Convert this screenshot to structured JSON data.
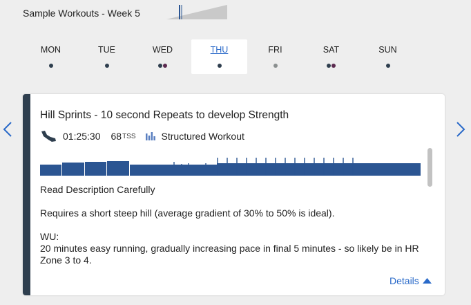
{
  "header": {
    "title": "Sample Workouts - Week 5"
  },
  "days": [
    {
      "label": "MON",
      "dots": [
        "#2e3e4e"
      ],
      "active": false
    },
    {
      "label": "TUE",
      "dots": [
        "#2e3e4e"
      ],
      "active": false
    },
    {
      "label": "WED",
      "dots": [
        "#2e3e4e",
        "#5b2a4f"
      ],
      "active": false
    },
    {
      "label": "THU",
      "dots": [
        "#2e3e4e"
      ],
      "active": true
    },
    {
      "label": "FRI",
      "dots": [
        "#8a8f8f"
      ],
      "active": false
    },
    {
      "label": "SAT",
      "dots": [
        "#2e3e4e",
        "#5b2a4f"
      ],
      "active": false
    },
    {
      "label": "SUN",
      "dots": [
        "#2e3e4e"
      ],
      "active": false
    }
  ],
  "nav": {
    "prev_icon": "chevron-left-icon",
    "next_icon": "chevron-right-icon"
  },
  "workout": {
    "title": "Hill Sprints - 10 second Repeats to develop Strength",
    "sport_icon": "running-shoe-icon",
    "duration": "01:25:30",
    "tss_value": "68",
    "tss_unit": "TSS",
    "type_icon": "bar-chart-icon",
    "type_label": "Structured Workout",
    "description": [
      "Read Description Carefully",
      "Requires a short steep hill (average gradient of 30% to 50% is ideal).",
      "WU:\n20 minutes easy running, gradually increasing pace in final 5 minutes - so likely be in HR Zone 3 to 4."
    ],
    "details_label": "Details"
  },
  "colors": {
    "accent": "#2a6ac9",
    "workout_bar": "#2b5592",
    "stripe": "#2e3e4e"
  }
}
